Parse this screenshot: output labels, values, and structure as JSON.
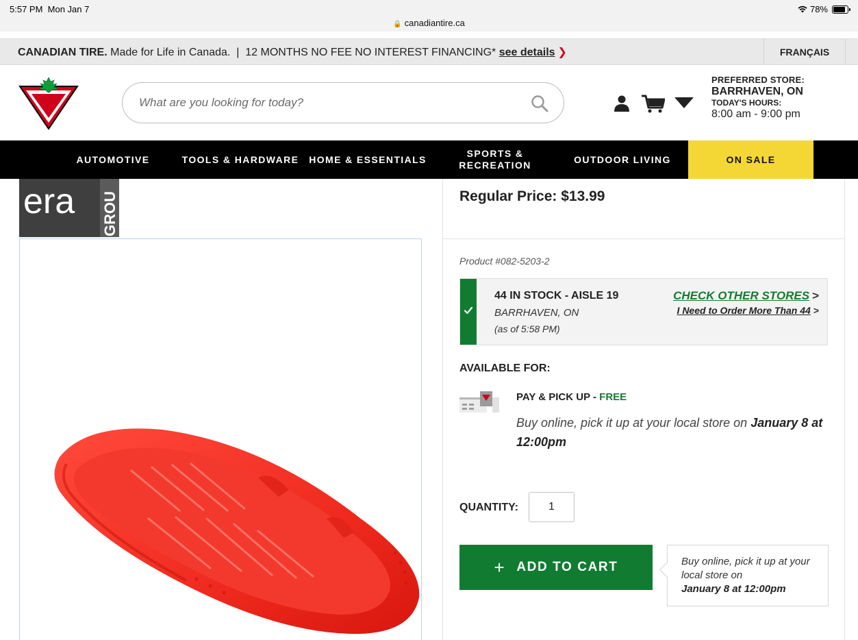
{
  "status_bar": {
    "time": "5:57 PM",
    "date": "Mon Jan 7",
    "url": "canadiantire.ca",
    "battery": "78%"
  },
  "promo": {
    "brand": "CANADIAN TIRE.",
    "tagline": "Made for Life in Canada.",
    "separator": "|",
    "financing": "12 MONTHS NO FEE NO INTEREST FINANCING*",
    "link": "see details",
    "language": "FRANÇAIS"
  },
  "header": {
    "search_placeholder": "What are you looking for today?",
    "store": {
      "label": "PREFERRED STORE:",
      "name": "BARRHAVEN, ON",
      "hours_label": "TODAY'S HOURS:",
      "hours": "8:00 am - 9:00 pm"
    }
  },
  "nav": {
    "items": [
      {
        "label": "AUTOMOTIVE"
      },
      {
        "label": "TOOLS & HARDWARE"
      },
      {
        "label": "HOME & ESSENTIALS"
      },
      {
        "label": "SPORTS &",
        "label2": "RECREATION"
      },
      {
        "label": "OUTDOOR LIVING"
      },
      {
        "label": "ON SALE"
      }
    ]
  },
  "brand": {
    "text": "era",
    "side_text": "GROU"
  },
  "product": {
    "price": "Regular Price: $13.99",
    "number": "Product #082-5203-2",
    "stock": {
      "title": "44 IN STOCK - AISLE 19",
      "store": "BARRHAVEN, ON",
      "as_of": "(as of 5:58 PM)",
      "check_other": "CHECK OTHER STORES",
      "order_more": "I Need to Order More Than 44"
    },
    "available_label": "AVAILABLE FOR:",
    "pickup": {
      "title": "PAY & PICK UP - ",
      "free": "FREE",
      "desc": "Buy online, pick it up at your local store on ",
      "date": "January 8 at 12:00pm"
    },
    "quantity_label": "QUANTITY:",
    "quantity": "1",
    "add_to_cart": "ADD TO CART",
    "tooltip": {
      "text": "Buy online, pick it up at your local store on",
      "date": "January 8 at 12:00pm"
    }
  },
  "colors": {
    "green": "#117c31",
    "red": "#e0261b",
    "sale_yellow": "#f4d734",
    "nav_black": "#000000"
  }
}
